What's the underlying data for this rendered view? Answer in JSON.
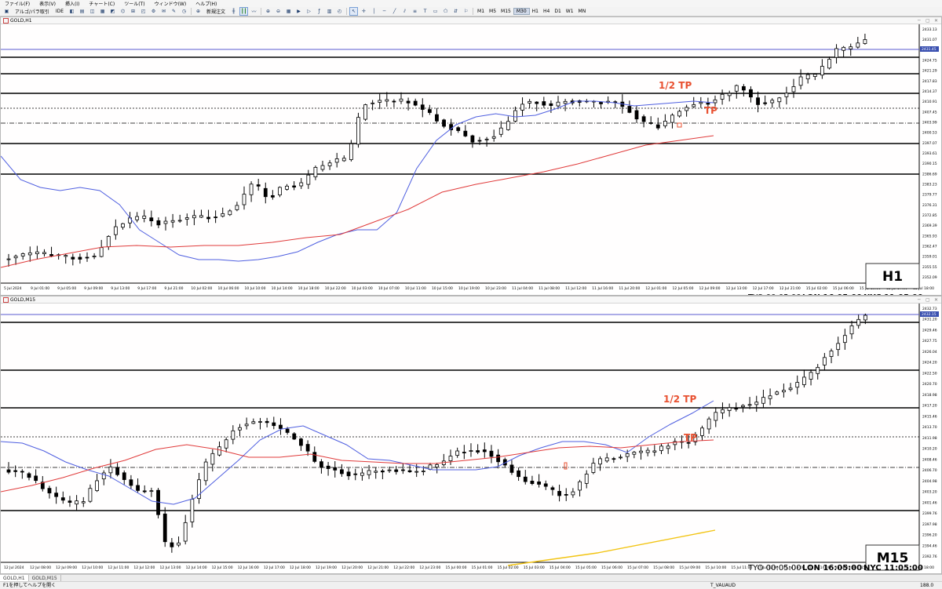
{
  "menu": [
    "ファイル(F)",
    "表示(V)",
    "挿入(I)",
    "チャート(C)",
    "ツール(T)",
    "ウィンドウ(W)",
    "ヘルプ(H)"
  ],
  "toolbar": {
    "account_label": "アルゴ/パラ取引",
    "ide_label": "IDE",
    "new_order_label": "新規注文",
    "timeframes": [
      "M1",
      "M5",
      "M15",
      "M30",
      "H1",
      "H4",
      "D1",
      "W1",
      "MN"
    ],
    "active_timeframe": "M30"
  },
  "charts": [
    {
      "window_title": "GOLD,H1",
      "timeframe_label": "H1",
      "session": {
        "tyo": "TYO 00:05:00",
        "lon": "LON 16:05:00",
        "nyc": "NYC 11:05:00"
      },
      "annotations": [
        {
          "text": "1/2 TP",
          "color": "#e85030"
        },
        {
          "text": "TP",
          "color": "#e85030"
        }
      ],
      "price_labels": [
        "2433.13",
        "2431.07",
        "2429.23",
        "2424.75",
        "2421.29",
        "2417.83",
        "2414.37",
        "2410.91",
        "2407.45",
        "2403.99",
        "2400.53",
        "2397.07",
        "2393.61",
        "2390.15",
        "2386.69",
        "2383.23",
        "2379.77",
        "2376.31",
        "2372.85",
        "2369.39",
        "2365.93",
        "2362.47",
        "2359.01",
        "2355.55",
        "2352.09"
      ],
      "current_price": "2431.45",
      "time_labels": [
        "5 Jul 2024",
        "9 Jul 01:00",
        "9 Jul 05:00",
        "9 Jul 09:00",
        "9 Jul 13:00",
        "9 Jul 17:00",
        "9 Jul 21:00",
        "10 Jul 02:00",
        "10 Jul 06:00",
        "10 Jul 10:00",
        "10 Jul 14:00",
        "10 Jul 18:00",
        "10 Jul 22:00",
        "10 Jul 03:00",
        "10 Jul 07:00",
        "10 Jul 11:00",
        "10 Jul 15:00",
        "10 Jul 19:00",
        "10 Jul 23:00",
        "11 Jul 04:00",
        "11 Jul 08:00",
        "11 Jul 12:00",
        "11 Jul 16:00",
        "11 Jul 20:00",
        "12 Jul 01:00",
        "12 Jul 05:00",
        "12 Jul 09:00",
        "12 Jul 13:00",
        "12 Jul 17:00",
        "12 Jul 21:00",
        "15 Jul 02:00",
        "15 Jul 06:00",
        "15 Jul 10:00",
        "15 Jul 14:00",
        "15 Jul 18:00"
      ]
    },
    {
      "window_title": "GOLD,M15",
      "timeframe_label": "M15",
      "session": {
        "tyo": "TYO 00:05:00",
        "lon": "LON 16:05:00",
        "nyc": "NYC 11:05:00"
      },
      "annotations": [
        {
          "text": "1/2 TP",
          "color": "#e85030"
        },
        {
          "text": "TP",
          "color": "#e85030"
        }
      ],
      "price_labels": [
        "2432.73",
        "2431.20",
        "2429.46",
        "2427.75",
        "2426.04",
        "2424.20",
        "2422.50",
        "2420.70",
        "2418.98",
        "2417.20",
        "2415.46",
        "2413.70",
        "2411.98",
        "2410.20",
        "2408.46",
        "2406.70",
        "2404.98",
        "2403.20",
        "2401.46",
        "2399.76",
        "2397.98",
        "2396.20",
        "2394.46",
        "2392.76"
      ],
      "current_price": "2432.15",
      "time_labels": [
        "12 Jul 2024",
        "12 Jul 08:00",
        "12 Jul 09:00",
        "12 Jul 10:00",
        "12 Jul 11:00",
        "12 Jul 12:00",
        "12 Jul 13:00",
        "12 Jul 14:00",
        "12 Jul 15:00",
        "12 Jul 16:00",
        "12 Jul 17:00",
        "12 Jul 18:00",
        "12 Jul 19:00",
        "12 Jul 20:00",
        "12 Jul 21:00",
        "12 Jul 22:00",
        "12 Jul 23:00",
        "15 Jul 00:00",
        "15 Jul 01:00",
        "15 Jul 02:00",
        "15 Jul 03:00",
        "15 Jul 04:00",
        "15 Jul 05:00",
        "15 Jul 06:00",
        "15 Jul 07:00",
        "15 Jul 08:00",
        "15 Jul 09:00",
        "15 Jul 10:00",
        "15 Jul 11:00",
        "15 Jul 12:00",
        "15 Jul 13:00",
        "15 Jul 14:00",
        "15 Jul 15:00",
        "15 Jul 16:00",
        "15 Jul 17:00",
        "15 Jul 18:00"
      ]
    }
  ],
  "tabs": [
    "GOLD,H1",
    "GOLD,M15"
  ],
  "status": {
    "help": "F1を押してヘルプを開く",
    "symbol": "T_VAUAUD",
    "zoom": "188.0"
  }
}
